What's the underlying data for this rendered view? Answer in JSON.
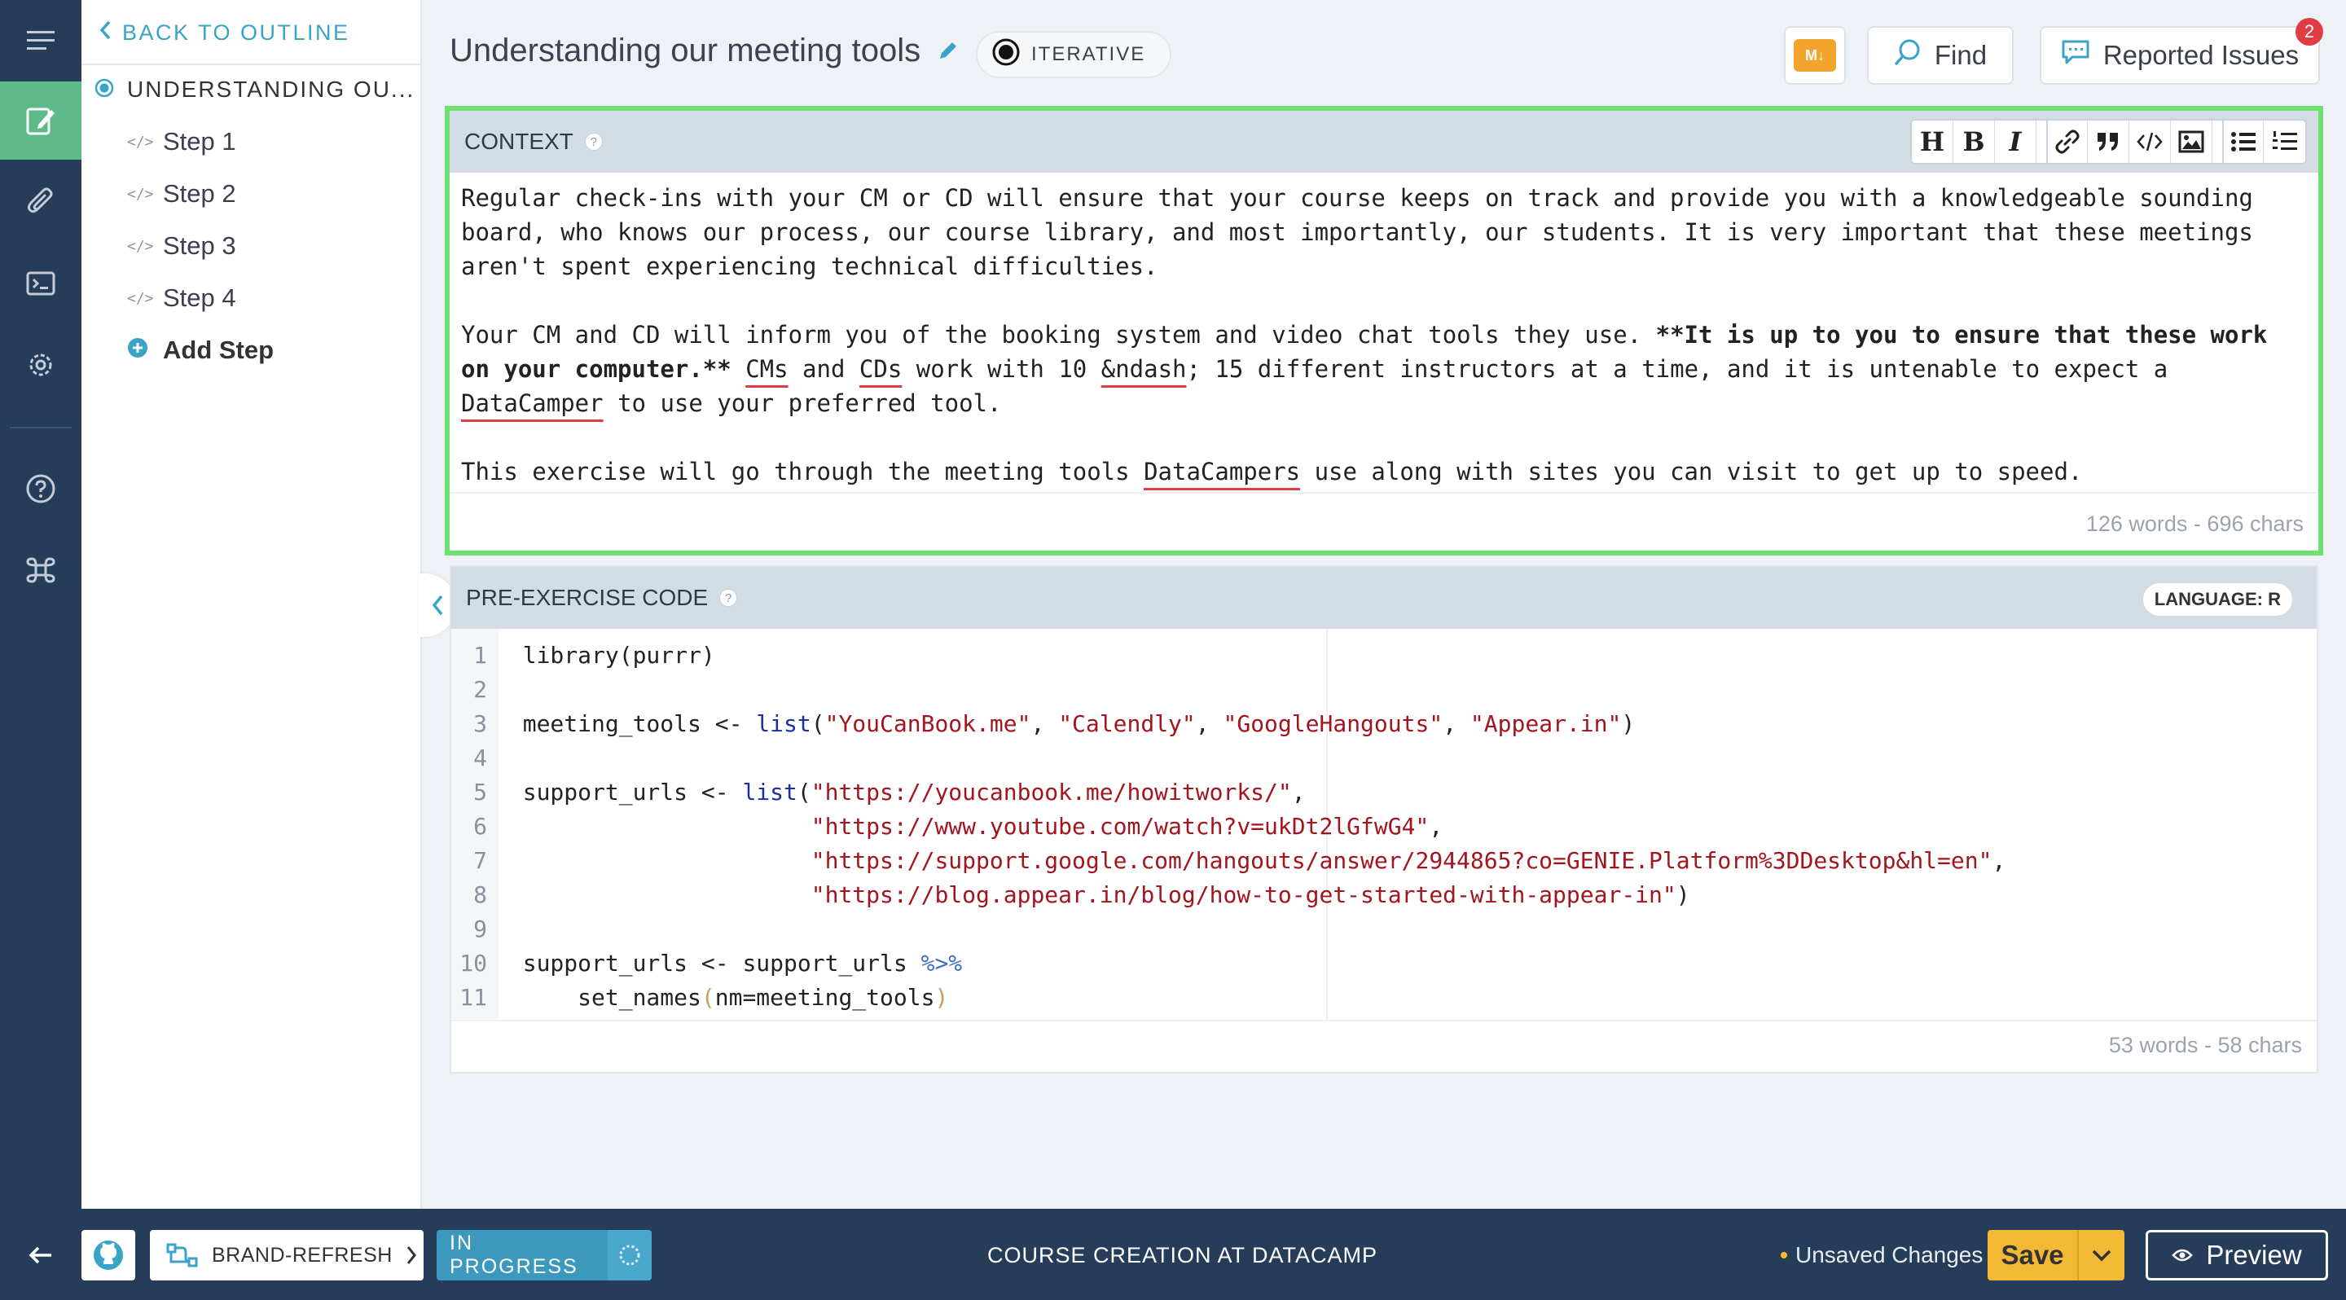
{
  "outline": {
    "back_label": "BACK TO OUTLINE",
    "chapter_title": "UNDERSTANDING OU...",
    "steps": [
      "Step 1",
      "Step 2",
      "Step 3",
      "Step 4"
    ],
    "add_step": "Add Step"
  },
  "header": {
    "title": "Understanding our meeting tools",
    "type_badge": "ITERATIVE",
    "md_icon": "M↓",
    "find_label": "Find",
    "issues_label": "Reported Issues",
    "issues_count": "2"
  },
  "context": {
    "heading": "CONTEXT",
    "toolbar": [
      "H",
      "B",
      "I",
      "link-icon",
      "quote-icon",
      "code-icon",
      "image-icon",
      "bullet-list-icon",
      "numbered-list-icon"
    ],
    "para1": "Regular check-ins with your CM or CD will ensure that your course keeps on track and provide you with a knowledgeable sounding board, who knows our process, our course library, and most importantly, our students. It is very important that these meetings aren't spent experiencing technical difficulties.",
    "para2_a": "Your CM and CD will inform you of the booking system and video chat tools they use. ",
    "para2_bold": "**It is up to you to ensure that these work on your computer.**",
    "para2_b": " ",
    "w_cms": "CMs",
    "w_and": " and ",
    "w_cds": "CDs",
    "para2_c": " work with 10 ",
    "w_ndash": "&ndash",
    "para2_d": "; 15 different instructors at a time, and it is untenable to expect a ",
    "w_datacamper": "DataCamper",
    "para2_e": " to use your preferred tool.",
    "para3_a": "This exercise will go through the meeting tools ",
    "w_datacampers": "DataCampers",
    "para3_b": " use along with sites you can visit to get up to speed.",
    "count": "126 words - 696 chars"
  },
  "pre_code": {
    "heading": "PRE-EXERCISE CODE",
    "language": "LANGUAGE: R",
    "count": "53 words - 58 chars",
    "lines": [
      [
        [
          "plain",
          "library(purrr)"
        ]
      ],
      [],
      [
        [
          "plain",
          "meeting_tools <- "
        ],
        [
          "fn",
          "list"
        ],
        [
          "plain",
          "("
        ],
        [
          "str",
          "\"YouCanBook.me\""
        ],
        [
          "plain",
          ", "
        ],
        [
          "str",
          "\"Calendly\""
        ],
        [
          "plain",
          ", "
        ],
        [
          "str",
          "\"GoogleHangouts\""
        ],
        [
          "plain",
          ", "
        ],
        [
          "str",
          "\"Appear.in\""
        ],
        [
          "plain",
          ")"
        ]
      ],
      [],
      [
        [
          "plain",
          "support_urls <- "
        ],
        [
          "fn",
          "list"
        ],
        [
          "plain",
          "("
        ],
        [
          "str",
          "\"https://youcanbook.me/howitworks/\""
        ],
        [
          "plain",
          ","
        ]
      ],
      [
        [
          "plain",
          "                     "
        ],
        [
          "str",
          "\"https://www.youtube.com/watch?v=ukDt2lGfwG4\""
        ],
        [
          "plain",
          ","
        ]
      ],
      [
        [
          "plain",
          "                     "
        ],
        [
          "str",
          "\"https://support.google.com/hangouts/answer/2944865?co=GENIE.Platform%3DDesktop&hl=en\""
        ],
        [
          "plain",
          ","
        ]
      ],
      [
        [
          "plain",
          "                     "
        ],
        [
          "str",
          "\"https://blog.appear.in/blog/how-to-get-started-with-appear-in\""
        ],
        [
          "plain",
          ")"
        ]
      ],
      [],
      [
        [
          "plain",
          "support_urls <- support_urls "
        ],
        [
          "op",
          "%>%"
        ]
      ],
      [
        [
          "plain",
          "    set_names"
        ],
        [
          "paren",
          "("
        ],
        [
          "plain",
          "nm=meeting_tools"
        ],
        [
          "paren",
          ")"
        ]
      ]
    ]
  },
  "bottom": {
    "branch": "BRAND-REFRESH",
    "status": "IN PROGRESS",
    "center": "COURSE CREATION AT DATACAMP",
    "unsaved": "Unsaved Changes",
    "save": "Save",
    "preview": "Preview"
  },
  "colors": {
    "rail": "#263d5a",
    "active_green": "#5fba89",
    "focus_border": "#6fdf72",
    "accent_blue": "#3aa3c8",
    "save_yellow": "#f3b834",
    "status_blue": "#3d98be"
  }
}
